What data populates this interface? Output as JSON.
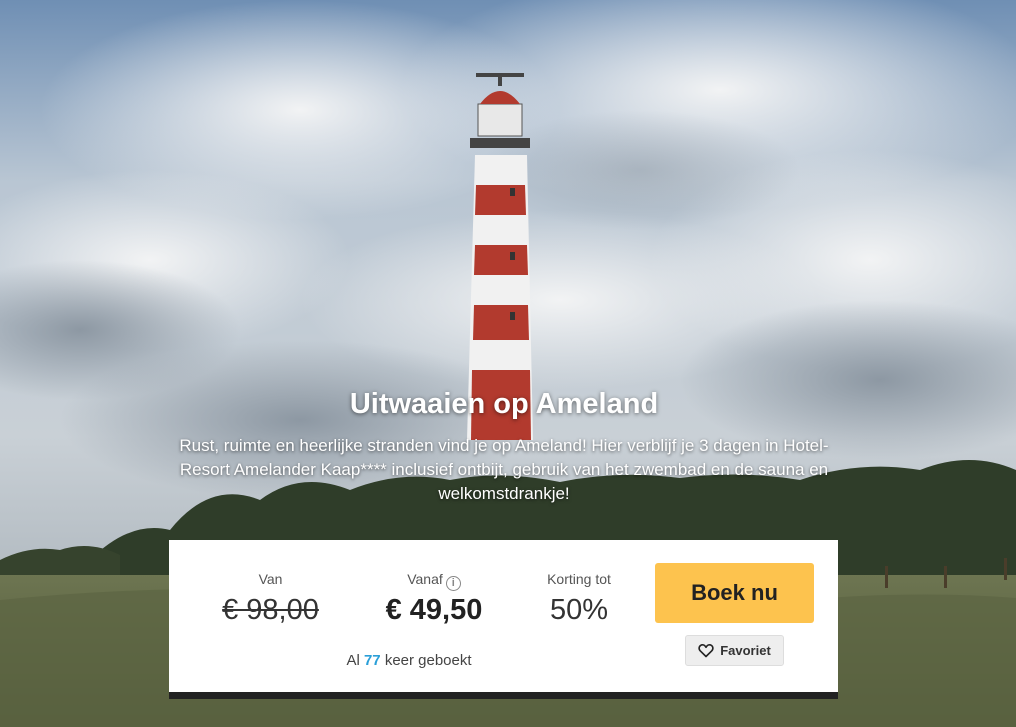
{
  "hero": {
    "title": "Uitwaaien op Ameland",
    "description": "Rust, ruimte en heerlijke stranden vind je op Ameland! Hier verblijf je 3 dagen in Hotel-Resort Amelander Kaap**** inclusief ontbijt, gebruik van het zwembad en de sauna en welkomstdrankje!"
  },
  "deal": {
    "van_label": "Van",
    "old_price": "€ 98,00",
    "vanaf_label": "Vanaf",
    "new_price": "€ 49,50",
    "korting_label": "Korting tot",
    "discount": "50%",
    "booked_prefix": "Al",
    "booked_count": "77",
    "booked_suffix": "keer geboekt",
    "book_label": "Boek nu",
    "favorite_label": "Favoriet"
  },
  "icons": {
    "info": "info-icon",
    "favorite": "heart-icon"
  },
  "colors": {
    "book_button": "#fdc34e",
    "booked_count": "#2a9fd8",
    "panel_border": "#222222"
  }
}
